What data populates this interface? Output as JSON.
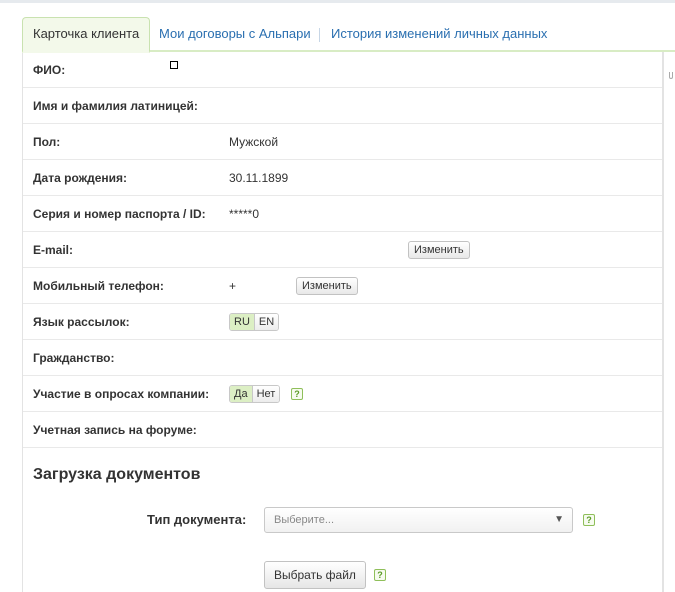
{
  "tabs": [
    {
      "label": "Карточка клиента",
      "active": true
    },
    {
      "label": "Мои договоры с Альпари",
      "active": false
    },
    {
      "label": "История изменений личных данных",
      "active": false
    }
  ],
  "profile": {
    "fio_label": "ФИО:",
    "fio_value": "",
    "latin_name_label": "Имя и фамилия латиницей:",
    "latin_name_value": "",
    "gender_label": "Пол:",
    "gender_value": "Мужской",
    "birthdate_label": "Дата рождения:",
    "birthdate_value": "30.11.1899",
    "passport_label": "Серия и номер паспорта / ID:",
    "passport_value": "*****0",
    "email_label": "E-mail:",
    "email_value": "",
    "email_change_label": "Изменить",
    "phone_label": "Мобильный телефон:",
    "phone_value": "+",
    "phone_change_label": "Изменить",
    "mailing_lang_label": "Язык рассылок:",
    "mailing_lang_options": [
      "RU",
      "EN"
    ],
    "mailing_lang_selected": "RU",
    "citizenship_label": "Гражданство:",
    "citizenship_value": "",
    "surveys_label": "Участие в опросах компании:",
    "surveys_options": [
      "Да",
      "Нет"
    ],
    "surveys_selected": "Да",
    "forum_label": "Учетная запись на форуме:",
    "forum_value": ""
  },
  "documents": {
    "title": "Загрузка документов",
    "type_label": "Тип документа:",
    "type_placeholder": "Выберите...",
    "caret": "▼",
    "choose_file_label": "Выбрать файл",
    "help_glyph": "?"
  },
  "colors": {
    "link": "#2a6fb0",
    "toggle_on": "#dcefc4",
    "help_border": "#8fbf5a"
  }
}
